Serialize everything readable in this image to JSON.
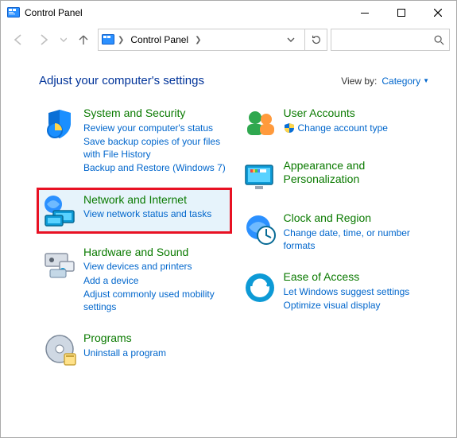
{
  "window": {
    "title": "Control Panel"
  },
  "toolbar": {
    "breadcrumb_root": "Control Panel",
    "search_placeholder": ""
  },
  "headline": "Adjust your computer's settings",
  "viewby": {
    "label": "View by:",
    "value": "Category"
  },
  "categories": {
    "left": [
      {
        "title": "System and Security",
        "links": [
          "Review your computer's status",
          "Save backup copies of your files with File History",
          "Backup and Restore (Windows 7)"
        ],
        "icon": "system-security-icon",
        "highlight": false
      },
      {
        "title": "Network and Internet",
        "links": [
          "View network status and tasks"
        ],
        "icon": "network-internet-icon",
        "highlight": true
      },
      {
        "title": "Hardware and Sound",
        "links": [
          "View devices and printers",
          "Add a device",
          "Adjust commonly used mobility settings"
        ],
        "icon": "hardware-sound-icon",
        "highlight": false
      },
      {
        "title": "Programs",
        "links": [
          "Uninstall a program"
        ],
        "icon": "programs-icon",
        "highlight": false
      }
    ],
    "right": [
      {
        "title": "User Accounts",
        "links": [
          "Change account type"
        ],
        "link_shield": [
          true
        ],
        "icon": "user-accounts-icon",
        "highlight": false
      },
      {
        "title": "Appearance and Personalization",
        "links": [],
        "icon": "appearance-icon",
        "highlight": false
      },
      {
        "title": "Clock and Region",
        "links": [
          "Change date, time, or number formats"
        ],
        "icon": "clock-region-icon",
        "highlight": false
      },
      {
        "title": "Ease of Access",
        "links": [
          "Let Windows suggest settings",
          "Optimize visual display"
        ],
        "icon": "ease-of-access-icon",
        "highlight": false
      }
    ]
  }
}
